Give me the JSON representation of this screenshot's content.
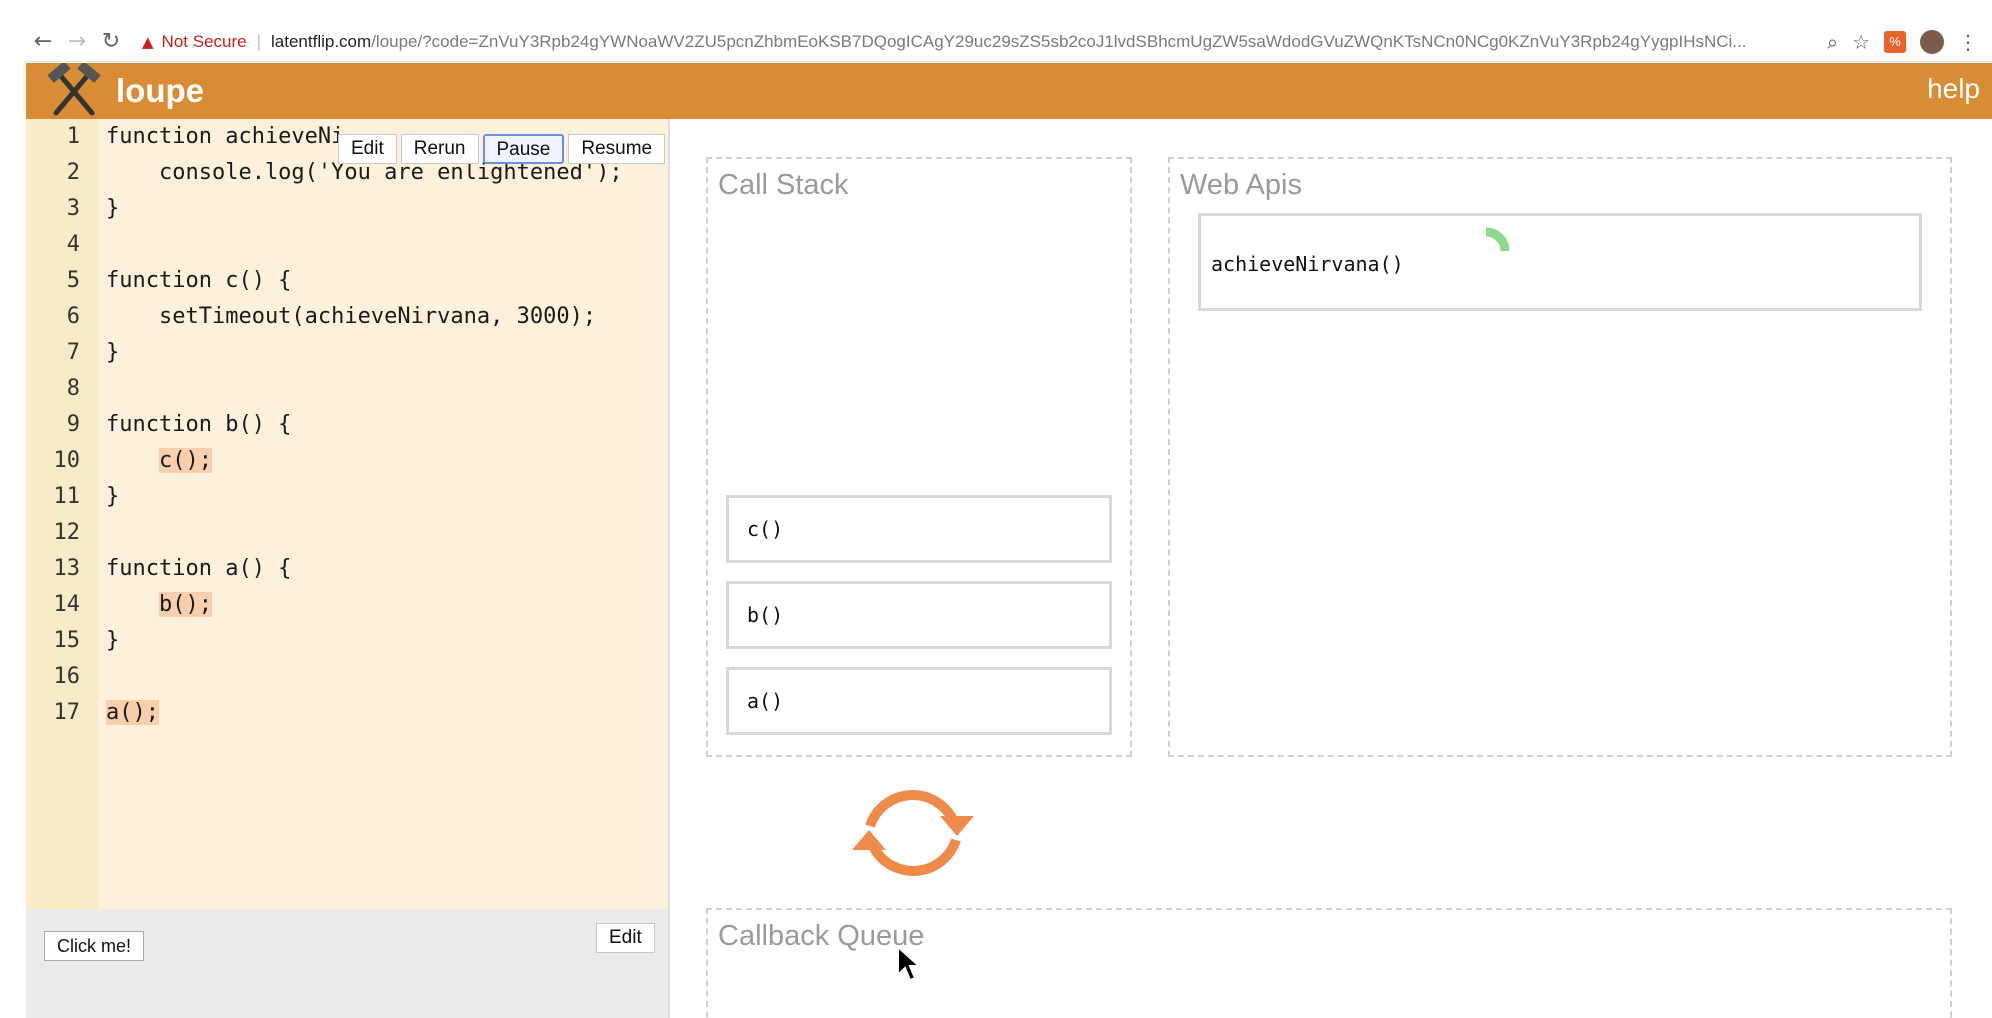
{
  "browser": {
    "security_label": "Not Secure",
    "url_domain": "latentflip.com",
    "url_path": "/loupe/?code=ZnVuY3Rpb24gYWNoaWV2ZU5pcnZhbmEoKSB7DQogICAgY29uc29sZS5sb2coJ1lvdSBhcmUgZW5saWdodGVuZWQnKTsNCn0NCg0KZnVuY3Rpb24gYygpIHsNCi..."
  },
  "app": {
    "title": "loupe",
    "help_label": "help"
  },
  "editor": {
    "buttons": {
      "edit": "Edit",
      "rerun": "Rerun",
      "pause": "Pause",
      "resume": "Resume"
    },
    "lines": [
      {
        "num": "1",
        "text": "function achieveNi",
        "highlight": false
      },
      {
        "num": "2",
        "text": "    console.log('You are enlightened');",
        "highlight": false
      },
      {
        "num": "3",
        "text": "}",
        "highlight": false
      },
      {
        "num": "4",
        "text": "",
        "highlight": false
      },
      {
        "num": "5",
        "text": "function c() {",
        "highlight": false
      },
      {
        "num": "6",
        "text": "    setTimeout(achieveNirvana, 3000);",
        "highlight": false
      },
      {
        "num": "7",
        "text": "}",
        "highlight": false
      },
      {
        "num": "8",
        "text": "",
        "highlight": false
      },
      {
        "num": "9",
        "text": "function b() {",
        "highlight": false
      },
      {
        "num": "10",
        "text": "c();",
        "highlight": true,
        "indent": "    "
      },
      {
        "num": "11",
        "text": "}",
        "highlight": false
      },
      {
        "num": "12",
        "text": "",
        "highlight": false
      },
      {
        "num": "13",
        "text": "function a() {",
        "highlight": false
      },
      {
        "num": "14",
        "text": "b();",
        "highlight": true,
        "indent": "    "
      },
      {
        "num": "15",
        "text": "}",
        "highlight": false
      },
      {
        "num": "16",
        "text": "",
        "highlight": false
      },
      {
        "num": "17",
        "text": "a();",
        "highlight": true
      }
    ]
  },
  "html_area": {
    "click_me_label": "Click me!",
    "edit_label": "Edit"
  },
  "call_stack": {
    "title": "Call Stack",
    "frames": [
      "c()",
      "b()",
      "a()"
    ]
  },
  "web_apis": {
    "title": "Web Apis",
    "items": [
      "achieveNirvana()"
    ]
  },
  "callback_queue": {
    "title": "Callback Queue"
  },
  "colors": {
    "header": "#d98c33",
    "editor_bg": "#fdf1dc",
    "highlight": "#f9cfae",
    "event_loop": "#ee8a4a",
    "spinner": "#8fd98f"
  }
}
